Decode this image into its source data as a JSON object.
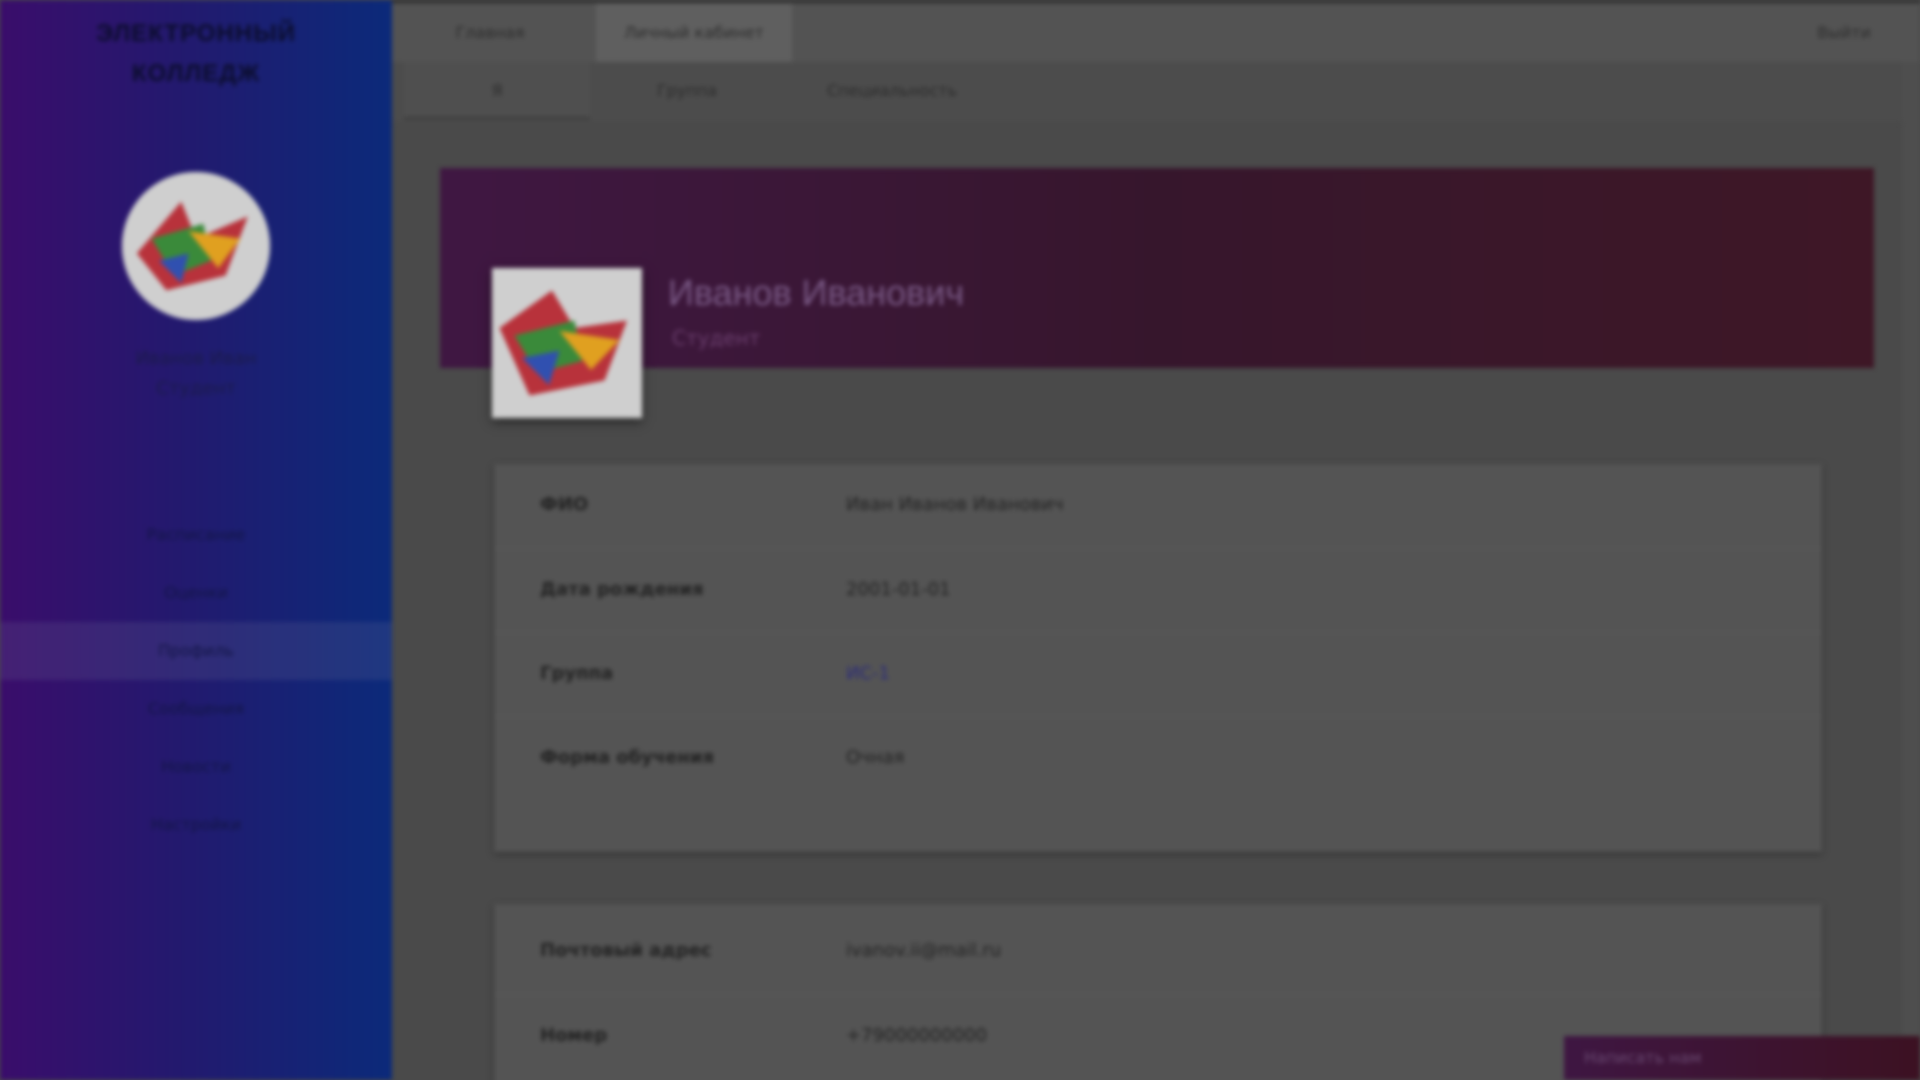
{
  "sidebar": {
    "brand_line1": "ЭЛЕКТРОННЫЙ",
    "brand_line2": "КОЛЛЕДЖ",
    "user_name": "Иванов Иван",
    "user_role": "Студент",
    "items": [
      {
        "label": "Расписание"
      },
      {
        "label": "Оценки"
      },
      {
        "label": "Профиль"
      },
      {
        "label": "Сообщения"
      },
      {
        "label": "Новости"
      },
      {
        "label": "Настройки"
      }
    ],
    "active_index": 2
  },
  "topbar": {
    "tabs": [
      {
        "label": "Главная"
      },
      {
        "label": "Личный кабинет"
      }
    ],
    "exit_label": "Выйти"
  },
  "subbar": {
    "tabs": [
      {
        "label": "Я"
      },
      {
        "label": "Группа"
      },
      {
        "label": "Специальность"
      }
    ]
  },
  "profile": {
    "banner_name": "Иванов Иванович",
    "banner_role": "Студент"
  },
  "card1": {
    "rows": [
      {
        "label": "ФИО",
        "value": "Иван Иванов Иванович"
      },
      {
        "label": "Дата рождения",
        "value": "2001-01-01"
      },
      {
        "label": "Группа",
        "value": "ИС-1"
      },
      {
        "label": "Форма обучения",
        "value": "Очная"
      }
    ]
  },
  "card2": {
    "rows": [
      {
        "label": "Почтовый адрес",
        "value": "ivanov.ii@mail.ru"
      },
      {
        "label": "Номер",
        "value": "+79000000000"
      }
    ]
  },
  "chatbar": {
    "label": "Написать нам"
  },
  "colors": {
    "sidebar_start": "#3a0d6b",
    "sidebar_end": "#0b2a7a",
    "banner": "#3b1636"
  }
}
